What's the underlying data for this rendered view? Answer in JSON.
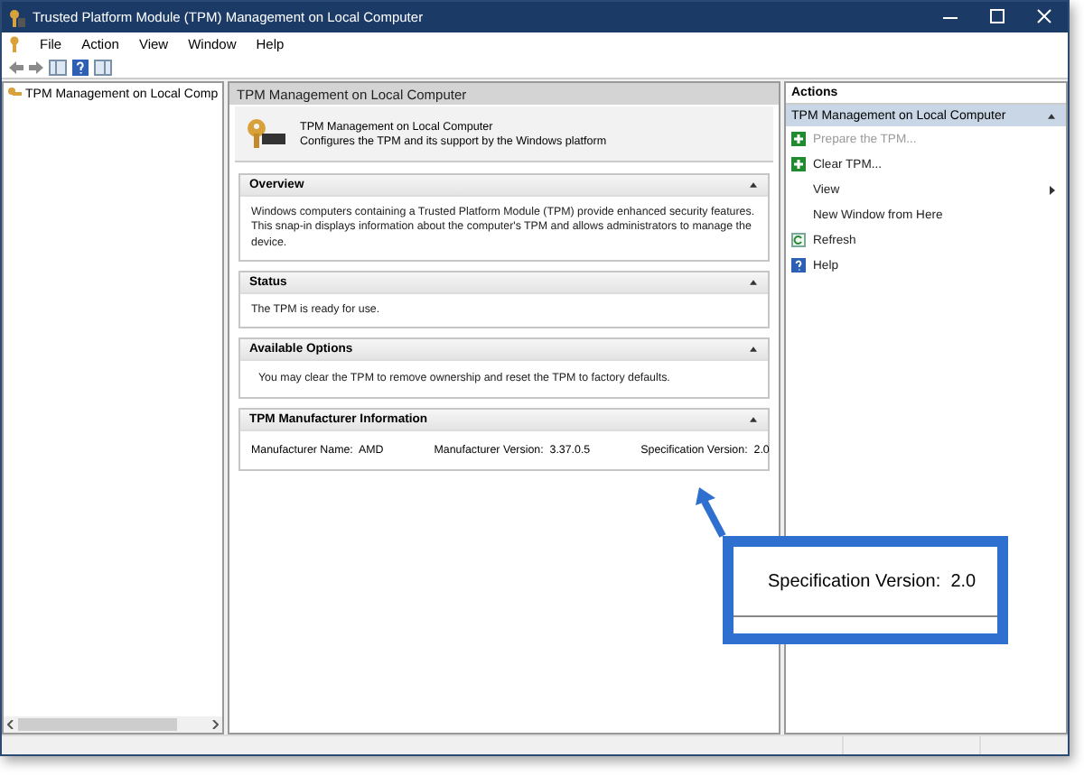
{
  "window": {
    "title": "Trusted Platform Module (TPM) Management on Local Computer"
  },
  "menu": [
    "File",
    "Action",
    "View",
    "Window",
    "Help"
  ],
  "tree": {
    "items": [
      {
        "label": "TPM Management on Local Comp"
      }
    ]
  },
  "center": {
    "header": "TPM Management on Local Computer",
    "intro": {
      "title": "TPM Management on Local Computer",
      "subtitle": "Configures the TPM and its support by the Windows platform"
    },
    "sections": [
      {
        "title": "Overview",
        "expanded": true,
        "kind": "text",
        "text": "Windows computers containing a Trusted Platform Module (TPM) provide enhanced security features. This snap-in displays information about the computer's TPM and allows administrators to manage the device."
      },
      {
        "title": "Status",
        "expanded": true,
        "kind": "text",
        "text": "The TPM is ready for use."
      },
      {
        "title": "Available Options",
        "expanded": true,
        "kind": "note",
        "text": "You may clear the TPM to remove ownership and reset the TPM to factory defaults."
      },
      {
        "title": "TPM Manufacturer Information",
        "expanded": true,
        "kind": "fields",
        "fields": [
          {
            "label": "Manufacturer Name:",
            "value": "AMD"
          },
          {
            "label": "Manufacturer Version:",
            "value": "3.37.0.5"
          },
          {
            "label": "Specification Version:",
            "value": "2.0"
          }
        ]
      }
    ]
  },
  "actions": {
    "title": "Actions",
    "group": {
      "title": "TPM Management on Local Computer",
      "expanded": true
    },
    "items": [
      {
        "label": "Prepare the TPM...",
        "kind": "plus",
        "disabled": true
      },
      {
        "label": "Clear TPM...",
        "kind": "plus",
        "disabled": false
      },
      {
        "label": "View",
        "kind": "submenu",
        "disabled": false
      },
      {
        "label": "New Window from Here",
        "kind": "plain",
        "disabled": false
      },
      {
        "label": "Refresh",
        "kind": "refresh",
        "disabled": false
      },
      {
        "label": "Help",
        "kind": "help",
        "disabled": false
      }
    ]
  },
  "callout": {
    "label": "Specification Version:",
    "value": "2.0"
  }
}
